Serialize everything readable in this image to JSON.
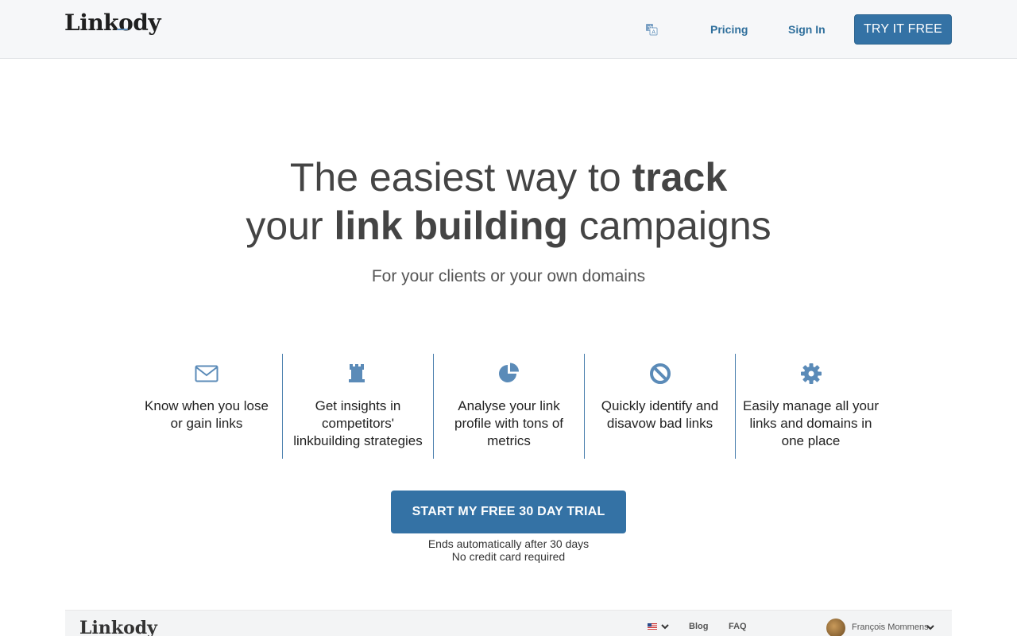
{
  "header": {
    "logo": "Linkody",
    "language_icon": "translate-icon",
    "nav": {
      "pricing": "Pricing",
      "sign_in": "Sign In"
    },
    "try_button": "TRY IT FREE"
  },
  "hero": {
    "title_line1_normal": "The easiest way to ",
    "title_line1_bold": "track",
    "title_line2_normal1": "your ",
    "title_line2_bold": "link building",
    "title_line2_normal2": " campaigns",
    "subtitle": "For your clients or your own domains"
  },
  "features": [
    {
      "icon": "envelope-icon",
      "text": "Know when you lose or gain links"
    },
    {
      "icon": "chess-rook-icon",
      "text": "Get insights in competitors' linkbuilding strategies"
    },
    {
      "icon": "pie-chart-icon",
      "text": "Analyse your link profile with tons of metrics"
    },
    {
      "icon": "ban-icon",
      "text": "Quickly identify and disavow bad links"
    },
    {
      "icon": "gear-icon",
      "text": "Easily manage all your links and domains in one place"
    }
  ],
  "cta": {
    "label": "START MY FREE 30 DAY TRIAL",
    "note1": "Ends automatically after 30 days",
    "note2": "No credit card required"
  },
  "preview": {
    "logo": "Linkody",
    "flag_icon": "us-flag-icon",
    "blog": "Blog",
    "faq": "FAQ",
    "user_name": "François Mommens"
  },
  "colors": {
    "accent": "#3472a5",
    "nav_link": "#2f6f9c",
    "icon": "#5b8bb8",
    "divider": "#4a7fae"
  }
}
